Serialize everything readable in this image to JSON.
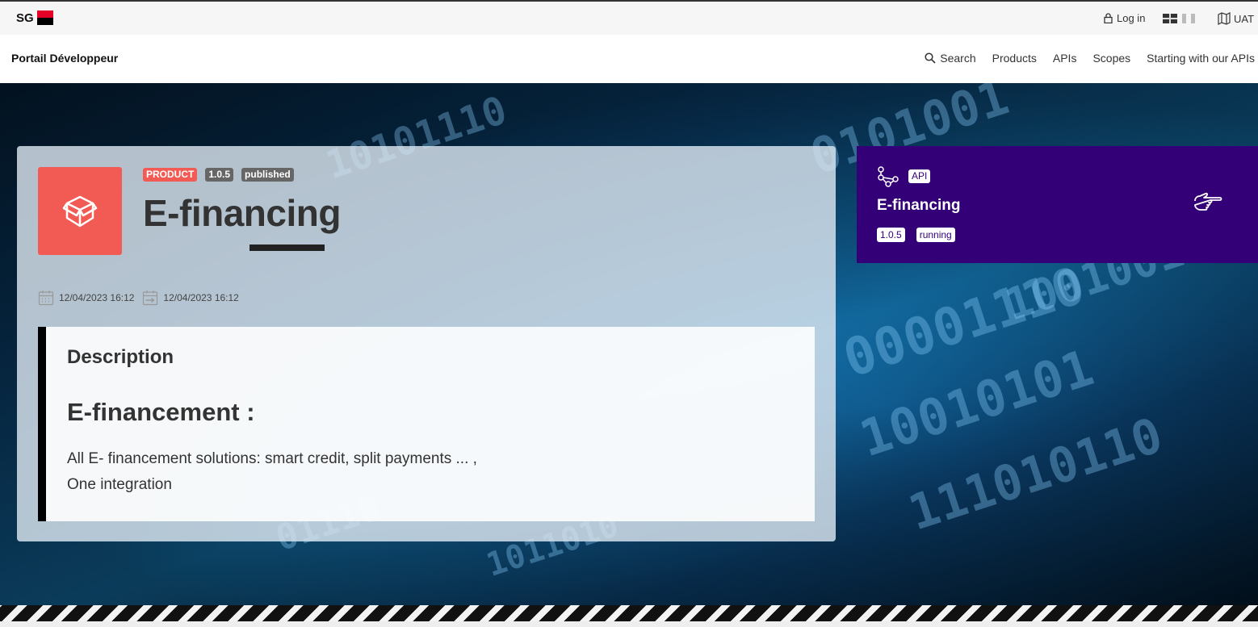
{
  "topbar": {
    "logo_text": "SG",
    "login_label": "Log in",
    "env_label": "UAT"
  },
  "navbar": {
    "title": "Portail Développeur",
    "links": [
      {
        "label": "Search",
        "icon": "search-icon"
      },
      {
        "label": "Products"
      },
      {
        "label": "APIs"
      },
      {
        "label": "Scopes"
      },
      {
        "label": "Starting with our APIs"
      }
    ]
  },
  "product": {
    "badges": [
      "PRODUCT",
      "1.0.5",
      "published"
    ],
    "title": "E-financing",
    "created": "12/04/2023 16:12",
    "updated": "12/04/2023 16:12",
    "icon": "box-icon",
    "color": "#f25a54"
  },
  "description": {
    "label": "Description",
    "heading": "E-financement :",
    "lines": [
      "All E- financement solutions: smart credit, split payments ... ,",
      "One integration"
    ]
  },
  "api_card": {
    "badge": "API",
    "title": "E-financing",
    "version": "1.0.5",
    "status": "running",
    "color": "#330077"
  },
  "hero_binary": [
    "10101110",
    "0101001",
    "00001110",
    "10010101",
    "111010110",
    "100100111",
    "01110",
    "1011010"
  ]
}
